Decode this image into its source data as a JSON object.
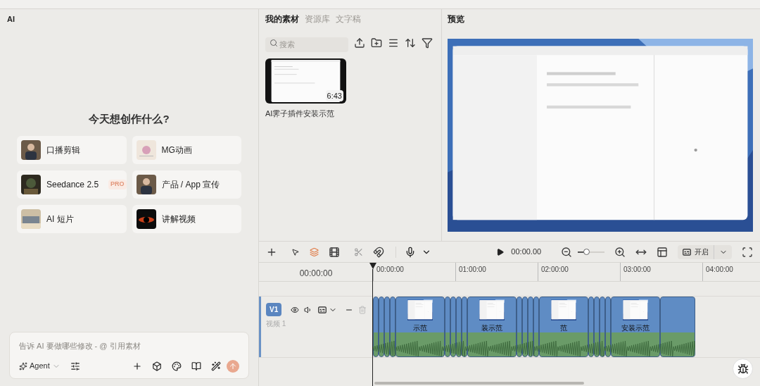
{
  "ai_panel": {
    "title": "AI",
    "heading": "今天想创作什么?",
    "templates": [
      {
        "label": "口播剪辑"
      },
      {
        "label": "MG动画"
      },
      {
        "label": "Seedance 2.5",
        "badge": "PRO"
      },
      {
        "label": "产品 / App 宣传"
      },
      {
        "label": "AI 短片"
      },
      {
        "label": "讲解视频"
      }
    ],
    "prompt": {
      "placeholder": "告诉 AI 要做哪些修改 - @ 引用素材",
      "mode": "Agent"
    }
  },
  "media_panel": {
    "tabs": [
      {
        "label": "我的素材",
        "selected": true
      },
      {
        "label": "资源库",
        "selected": false
      },
      {
        "label": "文字稿",
        "selected": false
      }
    ],
    "search": {
      "placeholder": "搜索"
    },
    "items": [
      {
        "name": "AI霁子插件安装示范",
        "duration": "6:43"
      }
    ]
  },
  "preview": {
    "title": "预览"
  },
  "timeline": {
    "toolbar": {
      "time": "00:00.00",
      "captions": "开启",
      "zoom": {
        "level": 0.3
      }
    },
    "timecode": "00:00:00",
    "ruler": [
      "00:00:00",
      "01:00:00",
      "02:00:00",
      "03:00:00",
      "04:00:00"
    ],
    "tracks": [
      {
        "badge": "V1",
        "name": "视频 1",
        "clips": [
          {
            "label": "示范"
          },
          {
            "label": "装示范"
          },
          {
            "label": "范"
          },
          {
            "label": "安装示范"
          }
        ]
      }
    ]
  }
}
